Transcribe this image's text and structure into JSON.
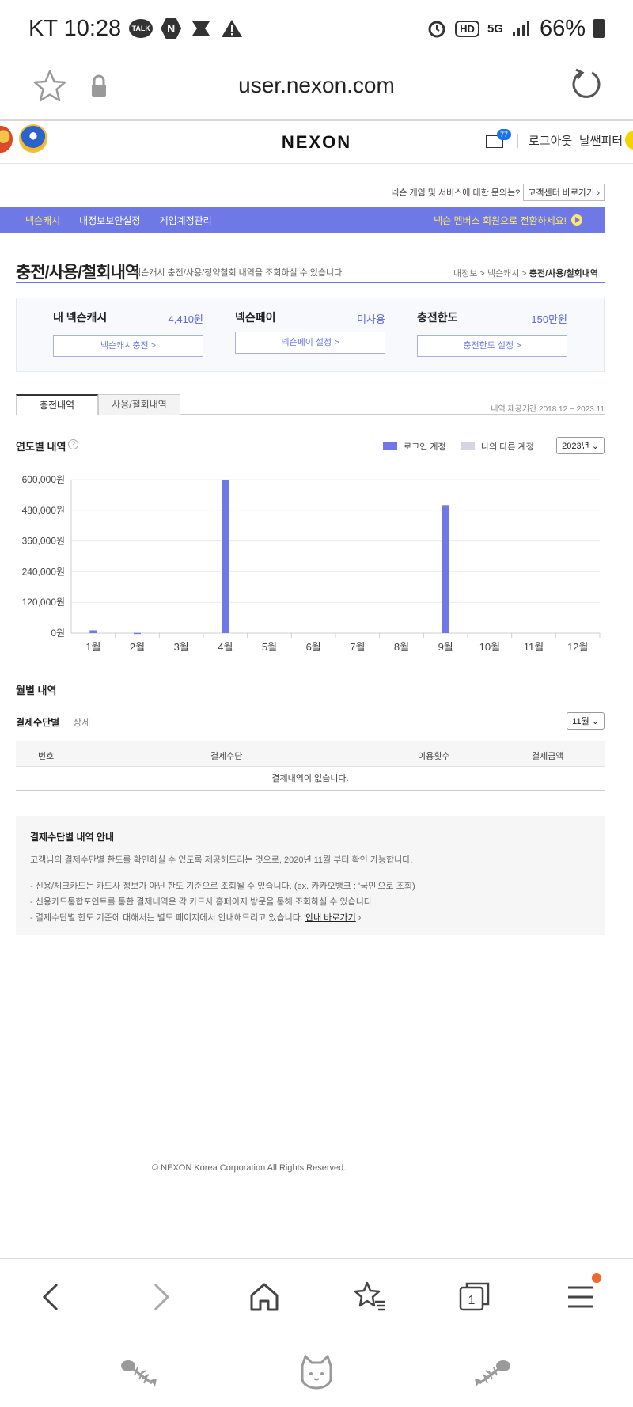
{
  "status": {
    "carrier_time": "KT 10:28",
    "hd": "HD",
    "network": "5G",
    "battery": "66%"
  },
  "browser": {
    "url": "user.nexon.com"
  },
  "header": {
    "logo": "NEXON",
    "mail_count": "77",
    "logout": "로그아웃",
    "username": "날쌘피터"
  },
  "help": {
    "question": "넥슨 게임 및 서비스에 대한 문의는?",
    "button": "고객센터 바로가기 ›"
  },
  "nav": {
    "tabs": [
      "넥슨캐시",
      "내정보보안설정",
      "게임계정관리"
    ],
    "promo": "넥슨 멤버스 회원으로 전환하세요!"
  },
  "section": {
    "title": "충전/사용/철회내역",
    "description": "넥슨캐시 충전/사용/청약철회 내역을 조회하실 수 있습니다.",
    "breadcrumb_prefix": "내정보 > 넥슨캐시 > ",
    "breadcrumb_current": "충전/사용/철회내역"
  },
  "cash": {
    "my_cash_label": "내 넥슨캐시",
    "my_cash_value": "4,410원",
    "my_cash_button": "넥슨캐시충전 >",
    "pay_label": "넥슨페이",
    "pay_value": "미사용",
    "pay_button": "넥슨페이 설정 >",
    "limit_label": "충전한도",
    "limit_value": "150만원",
    "limit_button": "충전한도 설정 >"
  },
  "tabs": {
    "charge": "충전내역",
    "use": "사용/철회내역",
    "period": "내역 제공기간 2018.12 ~ 2023.11"
  },
  "yearly": {
    "title": "연도별 내역",
    "help_icon": "?",
    "legend_login": "로그인 계정",
    "legend_other": "나의 다른 계정",
    "year_select": "2023년"
  },
  "chart_data": {
    "type": "bar",
    "categories": [
      "1월",
      "2월",
      "3월",
      "4월",
      "5월",
      "6월",
      "7월",
      "8월",
      "9월",
      "10월",
      "11월",
      "12월"
    ],
    "series": [
      {
        "name": "로그인 계정",
        "color": "#6e79e6",
        "values": [
          11000,
          1000,
          0,
          600000,
          0,
          0,
          0,
          0,
          500000,
          0,
          0,
          0
        ]
      },
      {
        "name": "나의 다른 계정",
        "color": "#d4d6e3",
        "values": [
          0,
          0,
          0,
          0,
          0,
          0,
          0,
          0,
          0,
          0,
          0,
          0
        ]
      }
    ],
    "ytick_labels": [
      "0원",
      "120,000원",
      "240,000원",
      "360,000원",
      "480,000원",
      "600,000원"
    ],
    "ylim": [
      0,
      600000
    ],
    "grid": true
  },
  "monthly": {
    "title": "월별 내역",
    "subtab_on": "결제수단별",
    "subtab_off": "상세",
    "month_select": "11월",
    "columns": [
      "번호",
      "결제수단",
      "이용횟수",
      "결제금액"
    ],
    "empty": "결제내역이 없습니다."
  },
  "notice": {
    "title": "결제수단별 내역 안내",
    "intro": "고객님의 결제수단별 한도를 확인하실 수 있도록 제공해드리는 것으로, 2020년 11월 부터 확인 가능합니다.",
    "line1": "- 신용/체크카드는 카드사 정보가 아닌 한도 기준으로 조회될 수 있습니다. (ex. 카카오뱅크 : '국민'으로 조회)",
    "line2": "- 신용카드통합포인트를 통한 결제내역은 각 카드사 홈페이지 방문을 통해 조회하실 수 있습니다.",
    "line3": "- 결제수단별 한도 기준에 대해서는 별도 페이지에서 안내해드리고 있습니다. ",
    "line3_link": "안내 바로가기"
  },
  "footer": {
    "copyright": "© NEXON Korea Corporation All Rights Reserved."
  },
  "bottom_tabs_count": "1"
}
